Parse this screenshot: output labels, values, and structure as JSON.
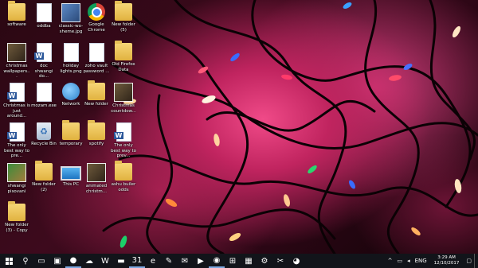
{
  "desktop": {
    "icons": [
      {
        "label": "software",
        "type": "folder"
      },
      {
        "label": "oddba",
        "type": "doc"
      },
      {
        "label": "classic-wo-sheme.jpg",
        "type": "image"
      },
      {
        "label": "Google Chrome",
        "type": "chrome"
      },
      {
        "label": "New folder (5)",
        "type": "folder"
      },
      {
        "label": "christmas wallpapers...",
        "type": "video"
      },
      {
        "label": "doc shwangi do...",
        "type": "word"
      },
      {
        "label": "holiday lights.png",
        "type": "doc"
      },
      {
        "label": "zoho vault password ...",
        "type": "doc"
      },
      {
        "label": "Old Firefox Data",
        "type": "folder"
      },
      {
        "label": "Christmas is just around...",
        "type": "word"
      },
      {
        "label": "mozam.exe",
        "type": "doc"
      },
      {
        "label": "Network",
        "type": "network"
      },
      {
        "label": "New folder",
        "type": "folder"
      },
      {
        "label": "Christmas countdow...",
        "type": "video"
      },
      {
        "label": "The only best way to pre...",
        "type": "word"
      },
      {
        "label": "Recycle Bin",
        "type": "recycle"
      },
      {
        "label": "temporary",
        "type": "folder"
      },
      {
        "label": "spotify",
        "type": "folder"
      },
      {
        "label": "The only best way to prev...",
        "type": "word"
      },
      {
        "label": "shwangi pisovani",
        "type": "person"
      },
      {
        "label": "New folder (2)",
        "type": "folder"
      },
      {
        "label": "This PC",
        "type": "pc"
      },
      {
        "label": "animated christm...",
        "type": "video"
      },
      {
        "label": "ashu builer odds",
        "type": "folder"
      },
      {
        "label": "New folder (3) - Copy",
        "type": "folder"
      }
    ]
  },
  "taskbar": {
    "items": [
      {
        "name": "search-icon",
        "glyph": "⚲"
      },
      {
        "name": "task-view-icon",
        "glyph": "▭"
      },
      {
        "name": "photos-app-icon",
        "glyph": "▣"
      },
      {
        "name": "firefox-icon",
        "glyph": "●"
      },
      {
        "name": "cloud-app-icon",
        "glyph": "☁"
      },
      {
        "name": "word-icon",
        "glyph": "W"
      },
      {
        "name": "file-explorer-icon",
        "glyph": "▬"
      },
      {
        "name": "calendar-icon",
        "glyph": "31"
      },
      {
        "name": "edge-icon",
        "glyph": "e"
      },
      {
        "name": "paint-app-icon",
        "glyph": "✎"
      },
      {
        "name": "mail-icon",
        "glyph": "✉"
      },
      {
        "name": "media-player-icon",
        "glyph": "▶"
      },
      {
        "name": "chrome-taskbar-icon",
        "glyph": "◉"
      },
      {
        "name": "store-icon",
        "glyph": "⊞"
      },
      {
        "name": "colorful-app-icon",
        "glyph": "▦"
      },
      {
        "name": "settings-icon",
        "glyph": "⚙"
      },
      {
        "name": "snipping-tool-icon",
        "glyph": "✂"
      },
      {
        "name": "chrome-user-icon",
        "glyph": "◕"
      }
    ],
    "tray": {
      "chevron": "^",
      "language": "ENG",
      "time": "3:29 AM",
      "date": "12/10/2017"
    }
  }
}
